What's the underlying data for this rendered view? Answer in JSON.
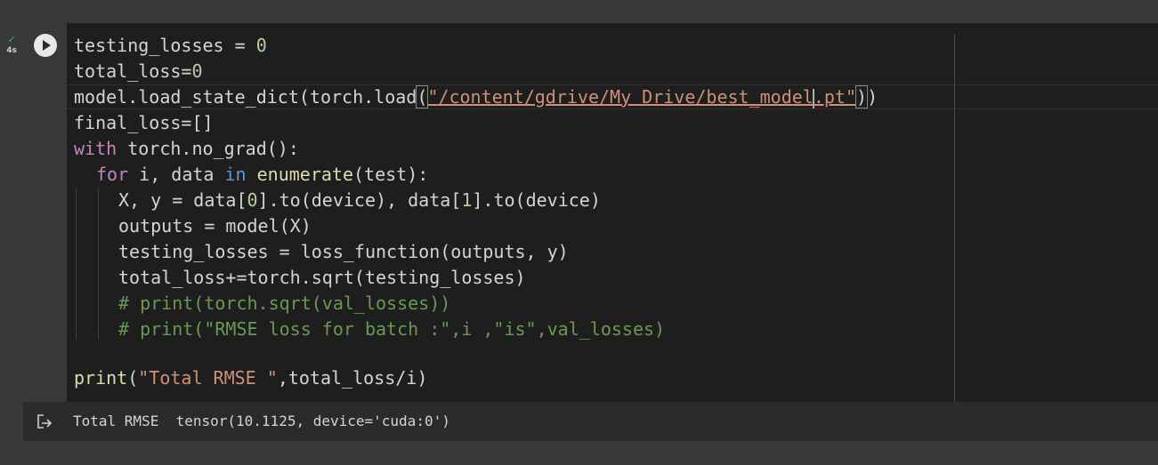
{
  "cell": {
    "status_icon": "check-icon",
    "exec_time": "4s",
    "run_icon": "play-icon",
    "output_icon": "output-redirect-icon"
  },
  "code": {
    "l1_a": "testing_losses = ",
    "l1_b": "0",
    "l2_a": "total_loss=",
    "l2_b": "0",
    "l3_a": "model.load_state_dict(torch.load",
    "l3_b": "(",
    "l3_c": "\"/content/gdrive/My Drive/best_model",
    "l3_d": ".pt\"",
    "l3_e": ")",
    "l3_f": ")",
    "l4": "final_loss=[]",
    "l5_kw": "with",
    "l5_rest": " torch.no_grad():",
    "l6_kw": "for",
    "l6_a": " i, data ",
    "l6_in": "in",
    "l6_sp": " ",
    "l6_fn": "enumerate",
    "l6_b": "(test):",
    "l7_a": "X, y = data[",
    "l7_b": "0",
    "l7_c": "].to(device), data[",
    "l7_d": "1",
    "l7_e": "].to(device)",
    "l8": "outputs = model(X)",
    "l9": "testing_losses = loss_function(outputs, y)",
    "l10": "total_loss+=torch.sqrt(testing_losses)",
    "l11": "# print(torch.sqrt(val_losses))",
    "l12": "# print(\"RMSE loss for batch :\",i ,\"is\",val_losses)",
    "l14_fn": "print",
    "l14_a": "(",
    "l14_str": "\"Total RMSE \"",
    "l14_b": ",total_loss/i)"
  },
  "output": {
    "text": "Total RMSE  tensor(10.1125, device='cuda:0')"
  }
}
